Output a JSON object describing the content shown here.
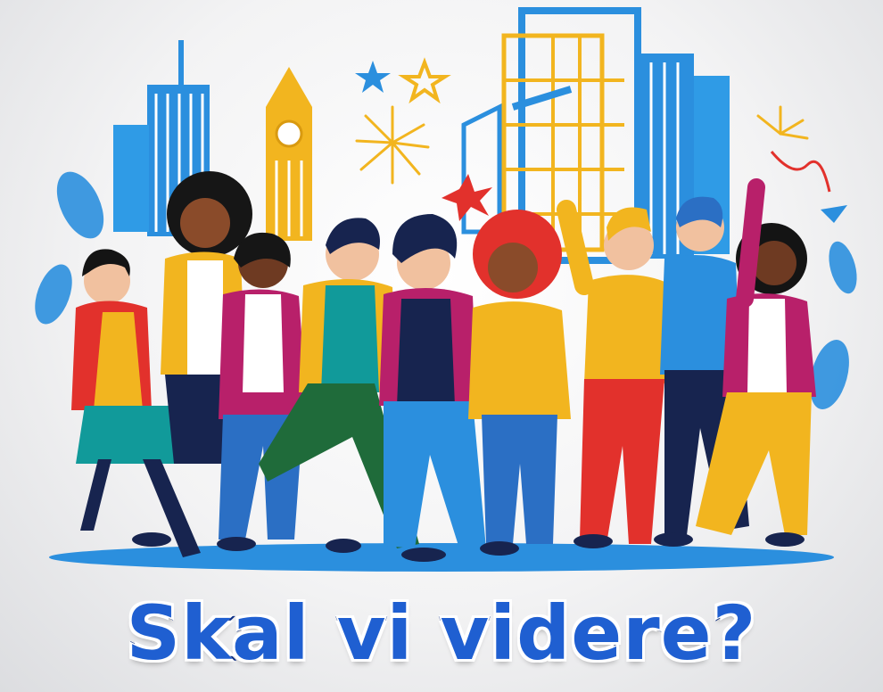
{
  "caption": "Skal vi videre?",
  "colors": {
    "caption_fill": "#1f5fd1",
    "caption_outline": "#0d2f86",
    "sky_blue": "#1e88d6",
    "gold": "#f2b51f",
    "red": "#e2312c",
    "magenta": "#b8206a",
    "navy": "#17244f",
    "green": "#1f6b3a",
    "teal": "#119a9a"
  },
  "icons": [
    "city-skyline-icon",
    "clock-tower-icon",
    "firework-icon",
    "star-icon",
    "people-crowd-icon"
  ]
}
